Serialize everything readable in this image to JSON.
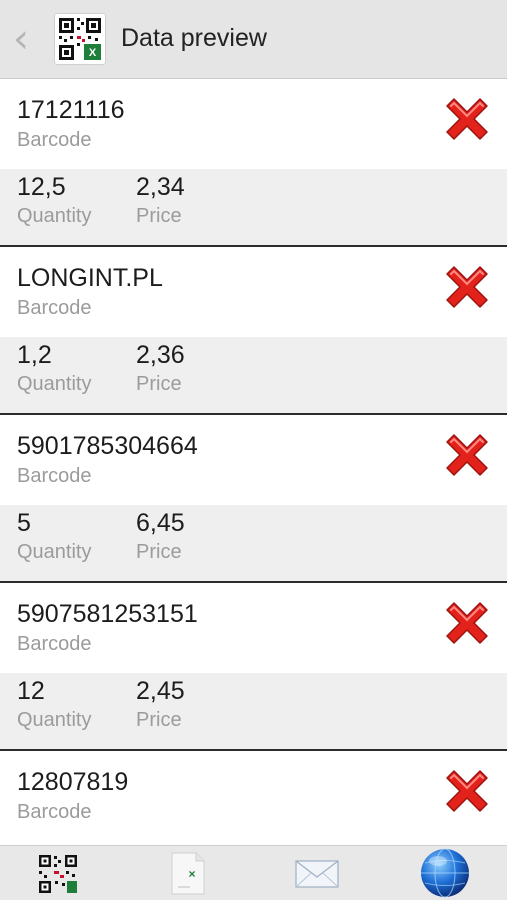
{
  "header": {
    "title": "Data preview",
    "back_icon": "chevron-left-icon",
    "logo_icon": "qr-excel-app-icon"
  },
  "labels": {
    "barcode": "Barcode",
    "quantity": "Quantity",
    "price": "Price"
  },
  "records": [
    {
      "barcode": "17121116",
      "quantity": "12,5",
      "price": "2,34"
    },
    {
      "barcode": "LONGINT.PL",
      "quantity": "1,2",
      "price": "2,36"
    },
    {
      "barcode": "5901785304664",
      "quantity": "5",
      "price": "6,45"
    },
    {
      "barcode": "5907581253151",
      "quantity": "12",
      "price": "2,45"
    },
    {
      "barcode": "12807819",
      "quantity": "",
      "price": ""
    }
  ],
  "toolbar": {
    "icons": [
      "qr-code-icon",
      "excel-file-icon",
      "mail-icon",
      "globe-icon"
    ]
  },
  "colors": {
    "delete": "#e3221b",
    "header_bg": "#e5e5e5",
    "row_alt_bg": "#efefef",
    "globe": "#1f6fd6"
  }
}
